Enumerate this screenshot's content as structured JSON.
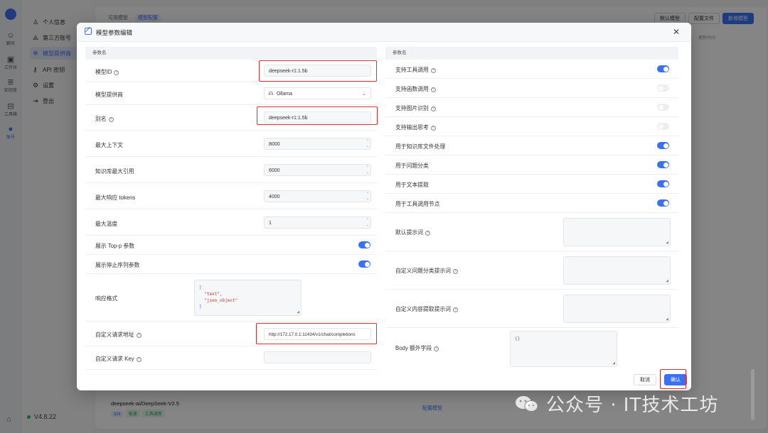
{
  "rail": {
    "items": [
      {
        "icon": "chat-icon",
        "label": "聊天"
      },
      {
        "icon": "workbench-icon",
        "label": "工作台"
      },
      {
        "icon": "database-icon",
        "label": "知识库"
      },
      {
        "icon": "toolbox-icon",
        "label": "工具箱"
      },
      {
        "icon": "account-icon",
        "label": "账号"
      }
    ]
  },
  "menu": {
    "items": [
      {
        "icon": "user-icon",
        "label": "个人信息"
      },
      {
        "icon": "third-party-icon",
        "label": "第三方账号"
      },
      {
        "icon": "model-provider-icon",
        "label": "模型提供商",
        "active": true
      },
      {
        "icon": "key-icon",
        "label": "API 密钥"
      },
      {
        "icon": "settings-icon",
        "label": "设置"
      },
      {
        "icon": "logout-icon",
        "label": "登出"
      }
    ],
    "version": "V4.8.22"
  },
  "background": {
    "tabs": [
      "可用模型",
      "模型配置"
    ],
    "buttons": {
      "default_model": "默认模型",
      "config_file": "配置文件",
      "add_model": "新增模型"
    },
    "subtext": "更新时间",
    "row": {
      "name": "deepseek-ai/DeepSeek-V2.5",
      "tags": [
        "32k",
        "极速",
        "工具调用"
      ],
      "config_label": "配置模型"
    }
  },
  "modal": {
    "title": "模型参数编辑",
    "left_header": "参数名",
    "right_header": "参数名",
    "model_id": {
      "label": "模型ID",
      "value": "deepseek-r1:1.5b"
    },
    "provider": {
      "label": "模型提供商",
      "value": "Ollama"
    },
    "alias": {
      "label": "别名",
      "value": "deepseek-r1:1.5b"
    },
    "max_context": {
      "label": "最大上下文",
      "value": "8000"
    },
    "kb_max_quote": {
      "label": "知识库最大引用",
      "value": "6000"
    },
    "max_tokens": {
      "label": "最大响应 tokens",
      "value": "4000"
    },
    "max_temp": {
      "label": "最大温度",
      "value": "1"
    },
    "show_top_p": {
      "label": "展示 Top-p 参数",
      "on": true
    },
    "show_stop_seq": {
      "label": "展示停止序列参数",
      "on": true
    },
    "response_format": {
      "label": "响应格式",
      "lines": [
        "[",
        "  \"text\",",
        "  \"json_object\"",
        "]"
      ]
    },
    "custom_url": {
      "label": "自定义请求地址",
      "value": "http://172.17.0.1:11434/v1/chat/completions"
    },
    "custom_key": {
      "label": "自定义请求 Key",
      "value": ""
    },
    "right_toggles": [
      {
        "label": "支持工具调用",
        "help": true,
        "on": true
      },
      {
        "label": "支持函数调用",
        "help": true,
        "on": false
      },
      {
        "label": "支持图片识别",
        "help": true,
        "on": false
      },
      {
        "label": "支持输出思考",
        "help": true,
        "on": false
      },
      {
        "label": "用于知识库文件处理",
        "help": false,
        "on": true
      },
      {
        "label": "用于问题分类",
        "help": false,
        "on": true
      },
      {
        "label": "用于文本提取",
        "help": false,
        "on": true
      },
      {
        "label": "用于工具调用节点",
        "help": false,
        "on": true
      }
    ],
    "default_prompt": {
      "label": "默认提示词"
    },
    "cq_prompt": {
      "label": "自定义问题分类提示词"
    },
    "extract_prompt": {
      "label": "自定义内容提取提示词"
    },
    "body_extra": {
      "label": "Body 额外字段",
      "value": "{}"
    },
    "cancel": "取消",
    "confirm": "确认"
  },
  "watermark": {
    "text": "公众号 · IT技术工坊"
  },
  "colors": {
    "accent": "#3b6ff5",
    "highlight": "#e02b2b"
  }
}
